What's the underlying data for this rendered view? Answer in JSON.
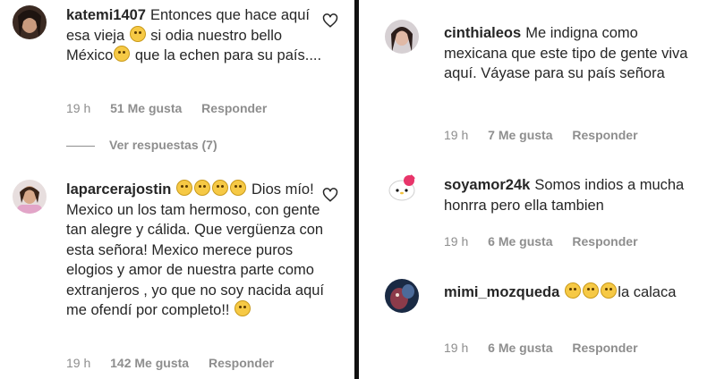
{
  "left": {
    "comments": [
      {
        "username": "katemi1407",
        "text": "Entonces que hace aquí esa vieja 😆 si odia nuestro bello México😞 que la echen para su país....",
        "parts": [
          "Entonces que hace aquí esa vieja ",
          " si odia nuestro bello México",
          " que la echen para su país...."
        ],
        "time": "19 h",
        "likes": "51 Me gusta",
        "reply": "Responder"
      },
      {
        "username": "laparcerajostin",
        "parts": [
          "",
          "Dios mío! Mexico un los tam hermoso, con gente tan alegre y cálida. Que vergüenza con esta señora! Mexico merece puros elogios y amor de nuestra parte como extranjeros , yo que no soy nacida aquí me ofendí por completo!! "
        ],
        "time": "19 h",
        "likes": "142 Me gusta",
        "reply": "Responder"
      }
    ],
    "view_replies": "Ver respuestas (7)"
  },
  "right": {
    "comments": [
      {
        "username": "cinthialeos",
        "text": "Me indigna como mexicana que este tipo de gente viva aquí. Váyase para su país señora",
        "time": "19 h",
        "likes": "7 Me gusta",
        "reply": "Responder"
      },
      {
        "username": "soyamor24k",
        "text": "Somos indios a mucha honrra pero ella tambien",
        "time": "19 h",
        "likes": "6 Me gusta",
        "reply": "Responder"
      },
      {
        "username": "mimi_mozqueda",
        "parts": [
          "",
          "la calaca"
        ],
        "time": "19 h",
        "likes": "6 Me gusta",
        "reply": "Responder"
      }
    ]
  },
  "icons": {
    "heart": "heart-outline-icon",
    "emoji_colors": {
      "face": "#f6c945",
      "outline": "#c99a1a"
    }
  }
}
